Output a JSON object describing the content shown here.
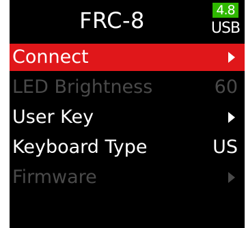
{
  "screen": {
    "title": "FRC-8",
    "battery": {
      "voltage": "4.8",
      "source": "USB",
      "level_color": "#2fb800"
    }
  },
  "menu": {
    "selected_color": "#e0171a",
    "items": [
      {
        "label": "Connect",
        "value": "",
        "arrow": "right-arrow-icon",
        "state": "selected"
      },
      {
        "label": "LED Brightness",
        "value": "60",
        "arrow": "",
        "state": "disabled"
      },
      {
        "label": "User Key",
        "value": "",
        "arrow": "right-arrow-icon",
        "state": "normal"
      },
      {
        "label": "Keyboard Type",
        "value": "US",
        "arrow": "",
        "state": "normal"
      },
      {
        "label": "Firmware",
        "value": "",
        "arrow": "right-arrow-icon",
        "state": "disabled"
      }
    ]
  }
}
